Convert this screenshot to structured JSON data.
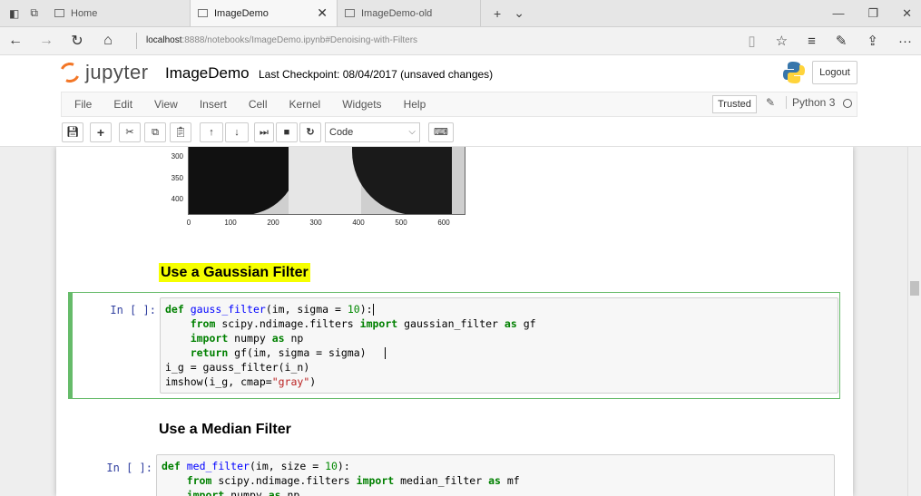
{
  "browser": {
    "tabs": [
      {
        "title": "Home",
        "active": false
      },
      {
        "title": "ImageDemo",
        "active": true
      },
      {
        "title": "ImageDemo-old",
        "active": false
      }
    ],
    "url_host": "localhost",
    "url_rest": ":8888/notebooks/ImageDemo.ipynb#Denoising-with-Filters"
  },
  "jupyter": {
    "logo_text": "jupyter",
    "notebook_title": "ImageDemo",
    "checkpoint": "Last Checkpoint: 08/04/2017 (unsaved changes)",
    "logout_label": "Logout",
    "menu": [
      "File",
      "Edit",
      "View",
      "Insert",
      "Cell",
      "Kernel",
      "Widgets",
      "Help"
    ],
    "trusted_label": "Trusted",
    "kernel_name": "Python 3",
    "cell_type": "Code"
  },
  "plot": {
    "yticks": [
      "300",
      "350",
      "400"
    ],
    "xticks": [
      "0",
      "100",
      "200",
      "300",
      "400",
      "500",
      "600"
    ]
  },
  "cells": {
    "heading1": "Use a Gaussian Filter",
    "heading2": "Use a Median Filter",
    "prompt1": "In [ ]:",
    "prompt2": "In [ ]:"
  }
}
